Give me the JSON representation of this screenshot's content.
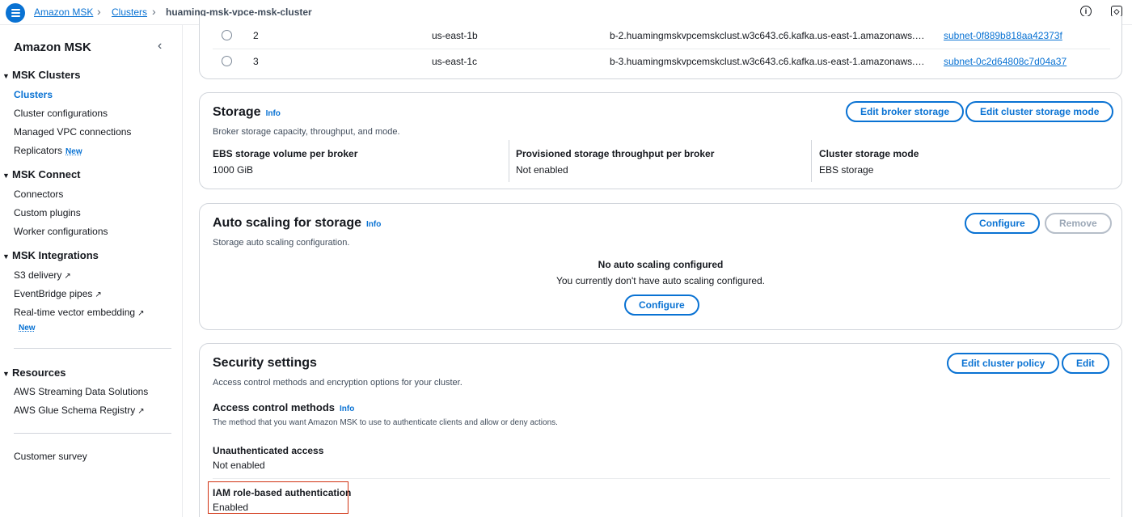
{
  "breadcrumb": {
    "service": "Amazon MSK",
    "section": "Clusters",
    "current": "huaming-msk-vpce-msk-cluster"
  },
  "topbar": {
    "info_icon": "info-icon",
    "settings_icon": "settings-icon"
  },
  "sidebar": {
    "title": "Amazon MSK",
    "sections": {
      "clusters": {
        "label": "MSK Clusters",
        "items": [
          "Clusters",
          "Cluster configurations",
          "Managed VPC connections",
          "Replicators"
        ]
      },
      "connect": {
        "label": "MSK Connect",
        "items": [
          "Connectors",
          "Custom plugins",
          "Worker configurations"
        ]
      },
      "integrations": {
        "label": "MSK Integrations",
        "items": [
          "S3 delivery",
          "EventBridge pipes",
          "Real-time vector embedding"
        ]
      },
      "resources": {
        "label": "Resources",
        "items": [
          "AWS Streaming Data Solutions",
          "AWS Glue Schema Registry"
        ]
      }
    },
    "new_badge": "New",
    "survey": "Customer survey"
  },
  "brokers": {
    "rows": [
      {
        "id": "2",
        "zone": "us-east-1b",
        "endpoint": "b-2.huamingmskvpcemskclust.w3c643.c6.kafka.us-east-1.amazonaws.…",
        "subnet": "subnet-0f889b818aa42373f"
      },
      {
        "id": "3",
        "zone": "us-east-1c",
        "endpoint": "b-3.huamingmskvpcemskclust.w3c643.c6.kafka.us-east-1.amazonaws.…",
        "subnet": "subnet-0c2d64808c7d04a37"
      }
    ]
  },
  "storage": {
    "title": "Storage",
    "info": "Info",
    "description": "Broker storage capacity, throughput, and mode.",
    "edit_broker_btn": "Edit broker storage",
    "edit_mode_btn": "Edit cluster storage mode",
    "fields": [
      {
        "label": "EBS storage volume per broker",
        "value": "1000 GiB"
      },
      {
        "label": "Provisioned storage throughput per broker",
        "value": "Not enabled"
      },
      {
        "label": "Cluster storage mode",
        "value": "EBS storage"
      }
    ]
  },
  "autoscaling": {
    "title": "Auto scaling for storage",
    "info": "Info",
    "description": "Storage auto scaling configuration.",
    "configure_btn": "Configure",
    "remove_btn": "Remove",
    "empty_title": "No auto scaling configured",
    "empty_text": "You currently don't have auto scaling configured.",
    "empty_configure_btn": "Configure"
  },
  "security": {
    "title": "Security settings",
    "description": "Access control methods and encryption options for your cluster.",
    "edit_policy_btn": "Edit cluster policy",
    "edit_btn": "Edit",
    "access_title": "Access control methods",
    "info": "Info",
    "access_desc": "The method that you want Amazon MSK to use to authenticate clients and allow or deny actions.",
    "unauth_label": "Unauthenticated access",
    "unauth_value": "Not enabled",
    "iam_label": "IAM role-based authentication",
    "iam_value": "Enabled"
  },
  "colors": {
    "accent": "#0972d3",
    "highlight": "#d13212",
    "border": "#d1d5db"
  }
}
